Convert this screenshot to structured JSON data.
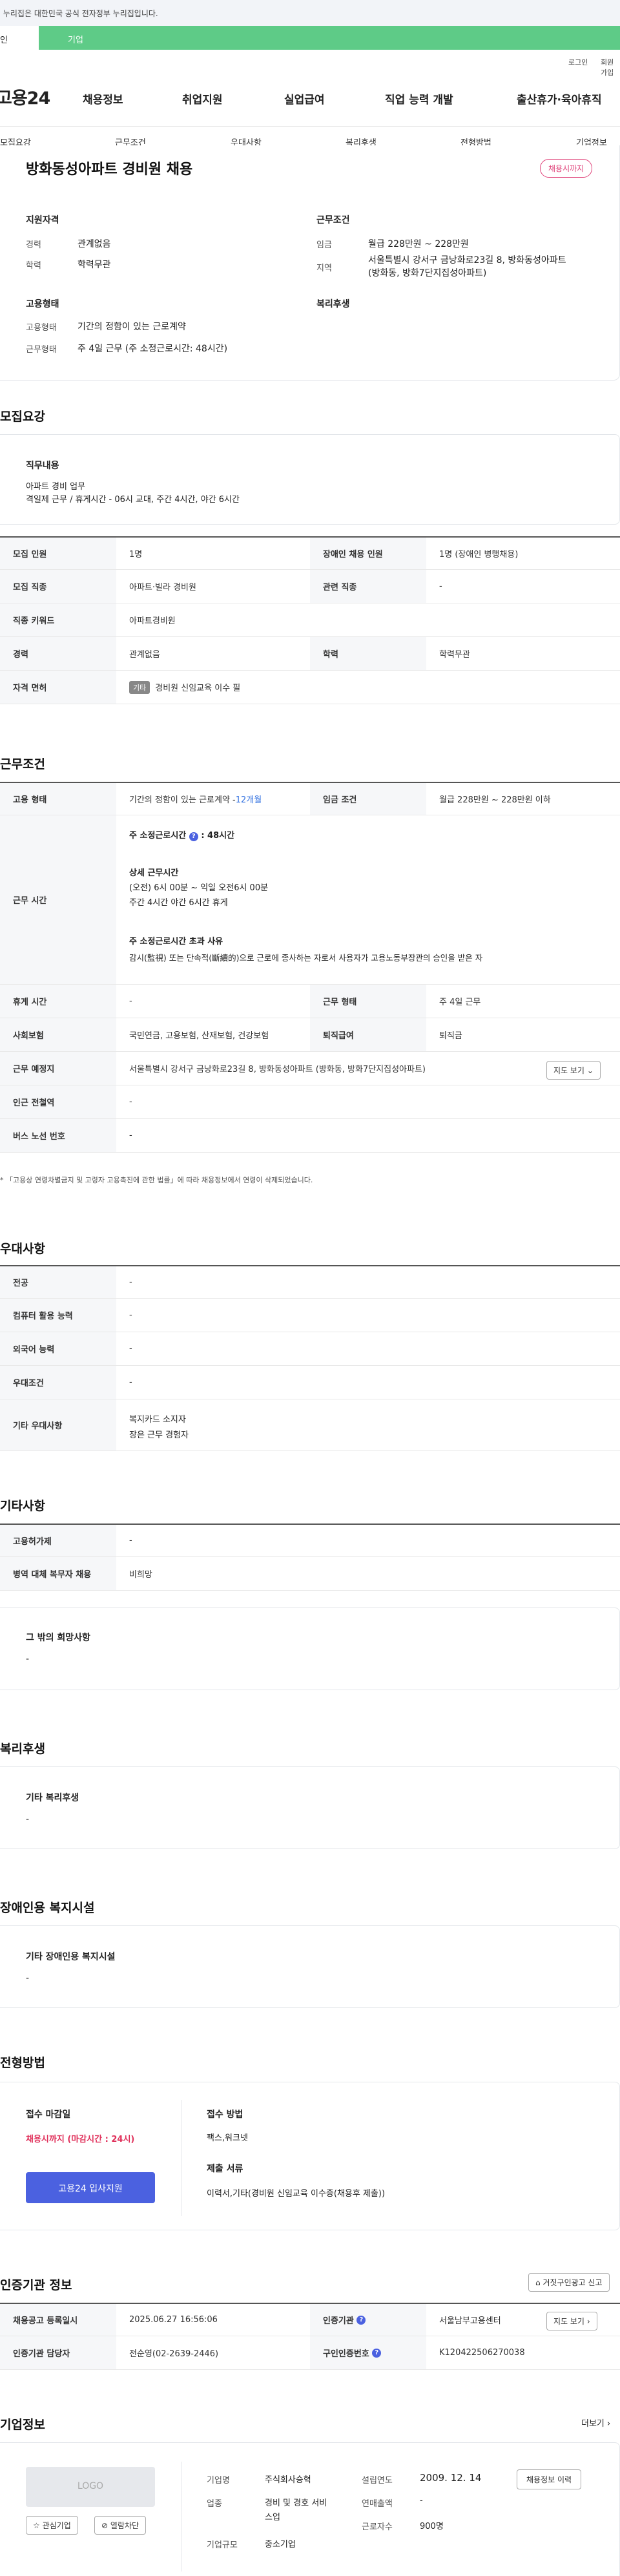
{
  "gov_banner": "이 누리집은 대한민국 공식 전자정부 누리집입니다.",
  "top_tabs": {
    "person": "개인",
    "company": "기업"
  },
  "util": {
    "login": "로그인",
    "signup": "회원가입"
  },
  "logo": "고용24",
  "gnb": [
    "채용정보",
    "취업지원",
    "실업급여",
    "직업 능력 개발",
    "출산휴가·육아휴직"
  ],
  "subnav": [
    "모집요강",
    "근무조건",
    "우대사항",
    "복리후생",
    "전형방법",
    "기업정보"
  ],
  "summary": {
    "title": "방화동성아파트 경비원 채용",
    "badge": "채용시까지",
    "qual_title": "지원자격",
    "career_label": "경력",
    "career_value": "관계없음",
    "edu_label": "학력",
    "edu_value": "학력무관",
    "emp_title": "고용형태",
    "emptype_label": "고용형태",
    "emptype_value": "기간의 정함이 있는 근로계약",
    "worktype_label": "근무형태",
    "worktype_value": "주 4일 근무 (주 소정근로시간: 48시간)",
    "cond_title": "근무조건",
    "wage_label": "임금",
    "wage_value": "월급 228만원 ~ 228만원",
    "region_label": "지역",
    "region_value1": "서울특별시 강서구 금낭화로23길 8, 방화동성아파트",
    "region_value2": "(방화동, 방화7단지집성아파트)",
    "welfare_title": "복리후생"
  },
  "recruit": {
    "section_title": "모집요강",
    "duty_title": "직무내용",
    "duty_line1": "아파트 경비 업무",
    "duty_line2": "격일제 근무 / 휴게시간 - 06시 교대, 주간 4시간, 야간 6시간",
    "rows": [
      {
        "th1": "모집 인원",
        "td1": "1명",
        "th2": "장애인 채용 인원",
        "td2": "1명 (장애인 병행채용)"
      },
      {
        "th1": "모집 직종",
        "td1": "아파트·빌라 경비원",
        "th2": "관련 직종",
        "td2": "-"
      },
      {
        "th1": "직종 키워드",
        "td1": "아파트경비원",
        "th2": "",
        "td2": ""
      },
      {
        "th1": "경력",
        "td1": "관계없음",
        "th2": "학력",
        "td2": "학력무관"
      }
    ],
    "license_th": "자격 면허",
    "license_tag": "기타",
    "license_td": "경비원 신임교육 이수 필"
  },
  "work": {
    "section_title": "근무조건",
    "emptype_th": "고용 형태",
    "emptype_td": "기간의 정함이 있는 근로계약 - ",
    "emptype_months": "12개월",
    "wage_th": "임금 조건",
    "wage_td": "월급 228만원 ~ 228만원 이하",
    "hours_th": "근무 시간",
    "hours_title1": "주 소정근로시간",
    "hours_val1": ": 48시간",
    "hours_title2": "상세 근무시간",
    "hours_line2a": "(오전) 6시 00분 ~ 익일 오전6시 00분",
    "hours_line2b": "주간 4시간  야간 6시간 휴게",
    "hours_title3": "주 소정근로시간 초과 사유",
    "hours_line3": "감시(監視) 또는 단속적(斷續的)으로 근로에 종사하는 자로서 사용자가 고용노동부장관의 승인을 받은 자",
    "rest_th": "휴게 시간",
    "rest_td": "-",
    "worktype_th": "근무 형태",
    "worktype_td": "주 4일 근무",
    "insure_th": "사회보험",
    "insure_td": "국민연금, 고용보험, 산재보험, 건강보험",
    "severance_th": "퇴직급여",
    "severance_td": "퇴직금",
    "place_th": "근무 예정지",
    "place_td": "서울특별시 강서구 금낭화로23길 8, 방화동성아파트 (방화동, 방화7단지집성아파트)",
    "map_btn": "지도 보기",
    "subway_th": "인근 전철역",
    "subway_td": "-",
    "bus_th": "버스 노선 번호",
    "bus_td": "-",
    "note": "* 「고용상 연령차별금지 및 고령자 고용촉진에 관한 법률」에 따라 채용정보에서 연령이 삭제되었습니다."
  },
  "pref": {
    "section_title": "우대사항",
    "rows": [
      {
        "th": "전공",
        "td": "-"
      },
      {
        "th": "컴퓨터 활용 능력",
        "td": "-"
      },
      {
        "th": "외국어 능력",
        "td": "-"
      },
      {
        "th": "우대조건",
        "td": "-"
      }
    ],
    "other_th": "기타 우대사항",
    "other_line1": "복지카드 소지자",
    "other_line2": "장은 근무 경험자"
  },
  "etc": {
    "section_title": "기타사항",
    "rows": [
      {
        "th": "고용허가제",
        "td": "-"
      },
      {
        "th": "병역 대체 복무자 채용",
        "td": "비희망"
      }
    ],
    "box_title": "그 밖의 희망사항",
    "box_value": "-"
  },
  "welfare": {
    "section_title": "복리후생",
    "box_title": "기타 복리후생",
    "box_value": "-"
  },
  "disability": {
    "section_title": "장애인용 복지시설",
    "box_title": "기타 장애인용 복지시설",
    "box_value": "-"
  },
  "screening": {
    "section_title": "전형방법",
    "deadline_title": "접수 마감일",
    "deadline_value": "채용시까지 (마감시간 : 24시)",
    "apply_btn": "고용24 입사지원",
    "method_title": "접수 방법",
    "method_value": "팩스,워크넷",
    "docs_title": "제출 서류",
    "docs_value": "이력서,기타(경비원 신임교육 이수증(채용후 제출))"
  },
  "agency": {
    "section_title": "인증기관 정보",
    "report_btn": "거짓구인광고 신고",
    "rows": [
      {
        "th1": "채용공고 등록일시",
        "td1": "2025.06.27 16:56:06",
        "th2": "인증기관",
        "td2": "서울남부고용센터"
      },
      {
        "th1": "인증기관 담당자",
        "td1": "전순영(02-2639-2446)",
        "th2": "구인인증번호",
        "td2": "K120422506270038"
      }
    ],
    "map_btn": "지도 보기"
  },
  "company": {
    "section_title": "기업정보",
    "more": "더보기",
    "logo_text": "LOGO",
    "fav_btn": "관심기업",
    "block_btn": "열람차단",
    "name_label": "기업명",
    "name_value": "주식회사승혁",
    "industry_label": "업종",
    "industry_value1": "경비 및 경호 서비",
    "industry_value2": "스업",
    "size_label": "기업규모",
    "size_value": "중소기업",
    "founded_label": "설립연도",
    "founded_value": "2009. 12. 14",
    "sales_label": "연매출액",
    "sales_value": "-",
    "employees_label": "근로자수",
    "employees_value": "900명",
    "history_btn": "채용정보 이력"
  }
}
